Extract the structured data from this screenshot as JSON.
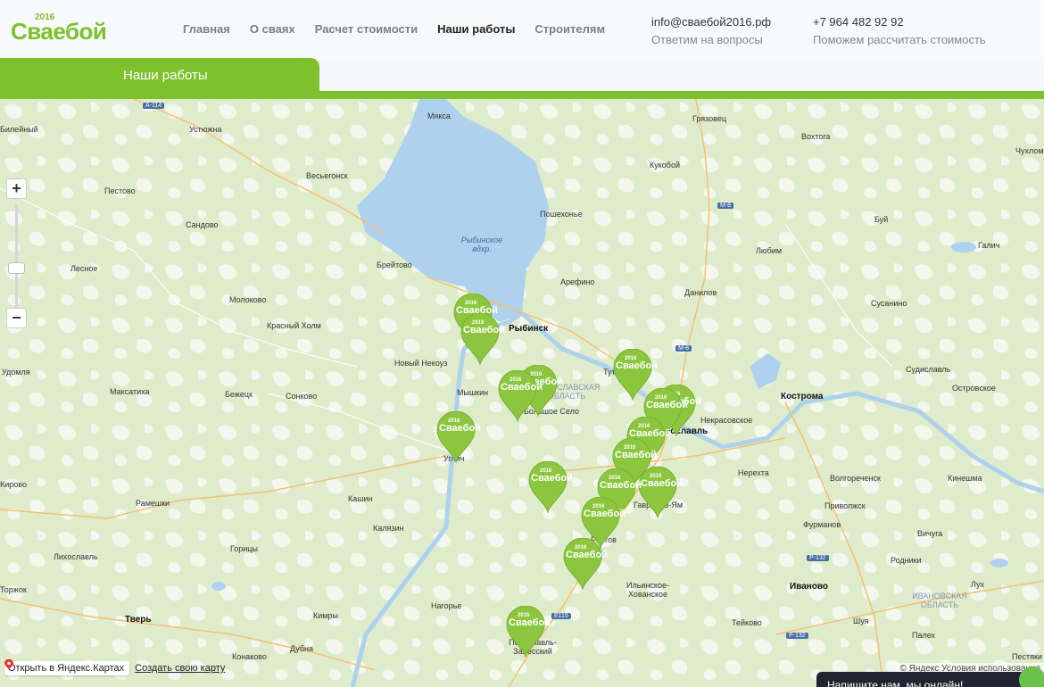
{
  "header": {
    "logo_text": "Сваебой",
    "logo_year": "2016",
    "nav": [
      {
        "label": "Главная"
      },
      {
        "label": "О сваях"
      },
      {
        "label": "Расчет стоимости"
      },
      {
        "label": "Наши работы",
        "active": true
      },
      {
        "label": "Строителям"
      }
    ],
    "email": "info@сваебой2016.рф",
    "email_sub": "Ответим на вопросы",
    "phone": "+7 964 482 92 92",
    "phone_sub": "Поможем рассчитать стоимость"
  },
  "tab": {
    "label": "Наши работы"
  },
  "map": {
    "zoom_in": "+",
    "zoom_out": "−",
    "open_link": "Открыть в Яндекс.Картах",
    "create_link": "Создать свою карту",
    "copyright": "© Яндекс Условия использования",
    "marker_label": "Сваебой",
    "marker_year": "2016",
    "lake_label": "Рыбинское вдхр.",
    "cities": [
      {
        "name": "Мякса"
      },
      {
        "name": "Грязовец"
      },
      {
        "name": "Вохтога"
      },
      {
        "name": "Чухлома"
      },
      {
        "name": "Устюжна"
      },
      {
        "name": "Весьегонск"
      },
      {
        "name": "Кукобой"
      },
      {
        "name": "Пестово"
      },
      {
        "name": "Пошехонье"
      },
      {
        "name": "Сандово"
      },
      {
        "name": "Буй"
      },
      {
        "name": "Галич"
      },
      {
        "name": "Лесное"
      },
      {
        "name": "Брейтово"
      },
      {
        "name": "Любим"
      },
      {
        "name": "Арефино"
      },
      {
        "name": "Молоково"
      },
      {
        "name": "Данилов"
      },
      {
        "name": "Сусанино"
      },
      {
        "name": "Красный Холм"
      },
      {
        "name": "Рыбинск"
      },
      {
        "name": "Удомля"
      },
      {
        "name": "Новый Некоуз"
      },
      {
        "name": "Судиславль"
      },
      {
        "name": "Максатиха"
      },
      {
        "name": "Бежецк"
      },
      {
        "name": "Сонково"
      },
      {
        "name": "Мышкин"
      },
      {
        "name": "Кострома"
      },
      {
        "name": "Островское"
      },
      {
        "name": "Некрасовское"
      },
      {
        "name": "Нерехта"
      },
      {
        "name": "Кинешма"
      },
      {
        "name": "Волгореченск"
      },
      {
        "name": "Приволжск"
      },
      {
        "name": "Фурманов"
      },
      {
        "name": "Кирово"
      },
      {
        "name": "Рамешки"
      },
      {
        "name": "Кашин"
      },
      {
        "name": "Калязин"
      },
      {
        "name": "Гаврилов-Ям"
      },
      {
        "name": "Лихославль"
      },
      {
        "name": "Горицы"
      },
      {
        "name": "Вичуга"
      },
      {
        "name": "Родники"
      },
      {
        "name": "Торжок"
      },
      {
        "name": "Иваново"
      },
      {
        "name": "Лух"
      },
      {
        "name": "Тверь"
      },
      {
        "name": "Нагорье"
      },
      {
        "name": "Ильинское-Хованское"
      },
      {
        "name": "Кимры"
      },
      {
        "name": "Тейково"
      },
      {
        "name": "Шуя"
      },
      {
        "name": "Дубна"
      },
      {
        "name": "Конаково"
      },
      {
        "name": "Переславль-Залесский"
      },
      {
        "name": "Палех"
      },
      {
        "name": "Пестяки"
      },
      {
        "name": "Билейный"
      },
      {
        "name": "Тутаев"
      },
      {
        "name": "Ярославль"
      },
      {
        "name": "Углич"
      },
      {
        "name": "Ростов"
      },
      {
        "name": "Большое Село"
      }
    ],
    "regions": [
      {
        "name": "ЯРОСЛАВСКАЯ ОБЛАСТЬ"
      },
      {
        "name": "ИВАНОВСКАЯ ОБЛАСТЬ"
      }
    ],
    "roads": [
      "А-114",
      "М-8",
      "М-8",
      "Р-132",
      "Р-132",
      "E115"
    ]
  },
  "chat": {
    "label": "Напишите нам, мы онлайн!"
  },
  "colors": {
    "brand_green": "#7dc22d",
    "marker_green": "#8cc63f",
    "water": "#aed1ee"
  }
}
